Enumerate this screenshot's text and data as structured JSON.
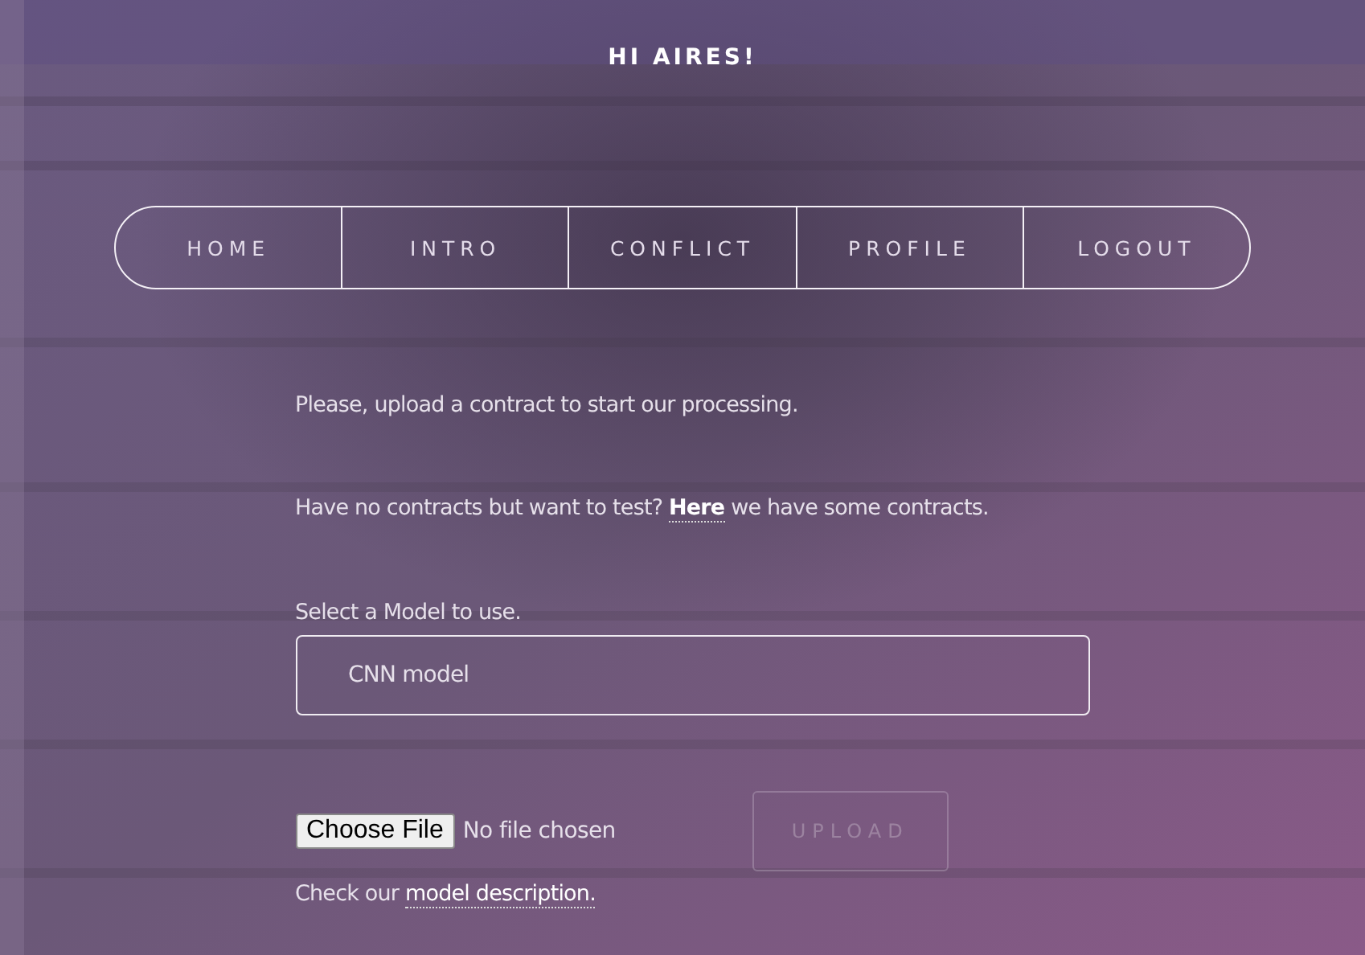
{
  "greeting": "HI AIRES!",
  "nav": [
    {
      "label": "HOME"
    },
    {
      "label": "INTRO"
    },
    {
      "label": "CONFLICT"
    },
    {
      "label": "PROFILE"
    },
    {
      "label": "LOGOUT"
    }
  ],
  "intro": "Please, upload a contract to start our processing.",
  "sample_note": {
    "before": "Have no contracts but want to test?",
    "link": "Here",
    "after": "we have some contracts."
  },
  "model_label": "Select a Model to use.",
  "model_select": {
    "value": "CNN model"
  },
  "file_input": {
    "button": "Choose File",
    "status": "No file chosen"
  },
  "upload_button": {
    "label": "UPLOAD",
    "disabled": true
  },
  "footer_note": {
    "before": "Check our",
    "link": "model description."
  }
}
